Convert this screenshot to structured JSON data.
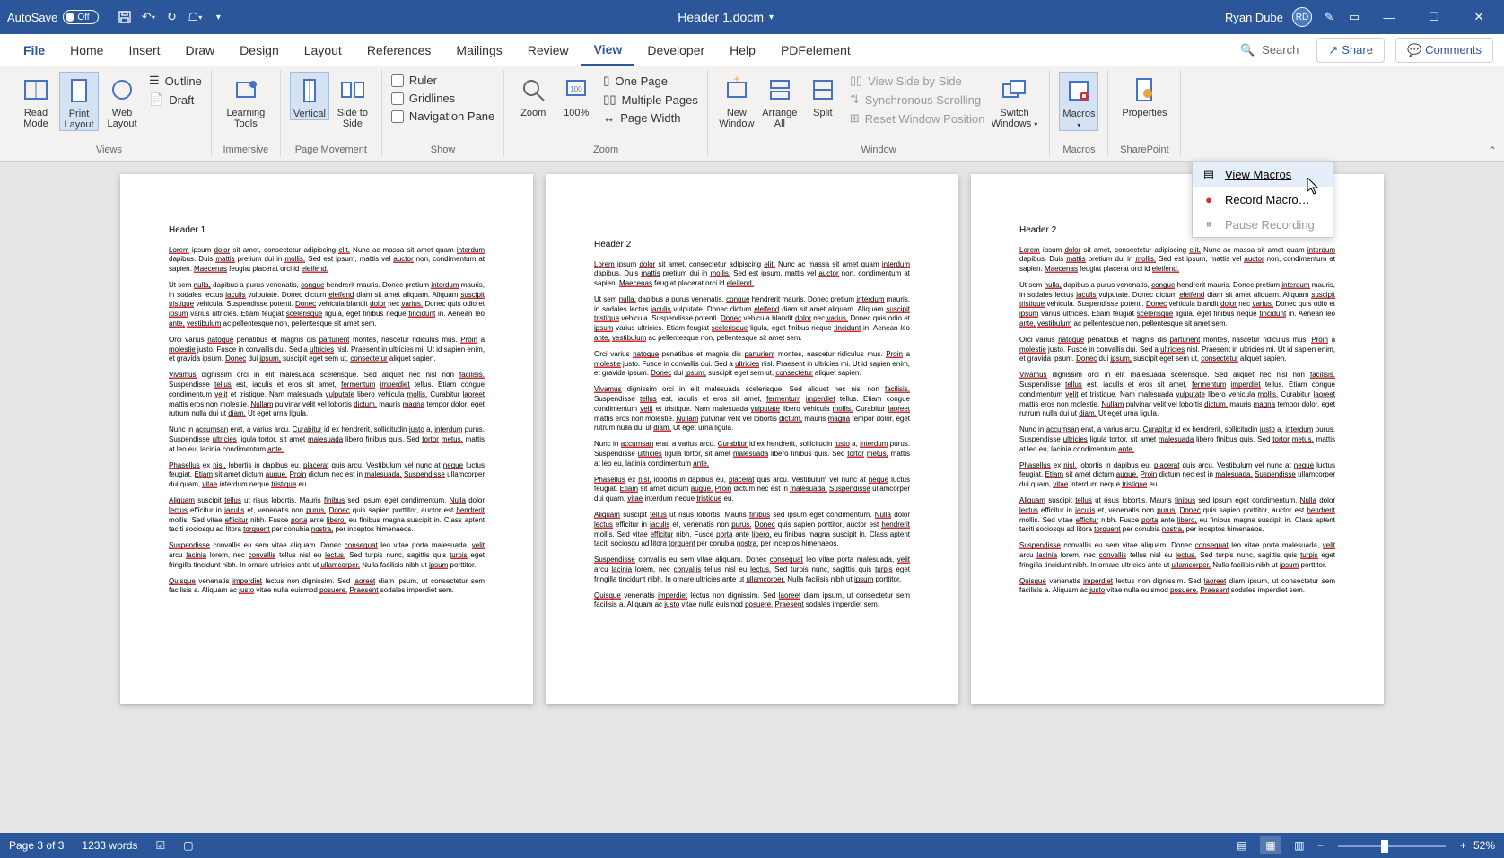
{
  "titlebar": {
    "autosave": "AutoSave",
    "autosave_state": "Off",
    "doc_title": "Header 1.docm",
    "user_name": "Ryan Dube",
    "user_initials": "RD"
  },
  "tabs": {
    "file": "File",
    "items": [
      "Home",
      "Insert",
      "Draw",
      "Design",
      "Layout",
      "References",
      "Mailings",
      "Review",
      "View",
      "Developer",
      "Help",
      "PDFelement"
    ],
    "active_index": 8,
    "search_placeholder": "Search",
    "share": "Share",
    "comments": "Comments"
  },
  "ribbon": {
    "groups": {
      "views": {
        "label": "Views",
        "read_mode": "Read Mode",
        "print_layout": "Print Layout",
        "web_layout": "Web Layout",
        "outline": "Outline",
        "draft": "Draft"
      },
      "immersive": {
        "label": "Immersive",
        "learning_tools": "Learning Tools"
      },
      "page_movement": {
        "label": "Page Movement",
        "vertical": "Vertical",
        "side": "Side to Side"
      },
      "show": {
        "label": "Show",
        "ruler": "Ruler",
        "gridlines": "Gridlines",
        "nav": "Navigation Pane"
      },
      "zoom": {
        "label": "Zoom",
        "zoom": "Zoom",
        "hundred": "100%",
        "one_page": "One Page",
        "multi": "Multiple Pages",
        "page_width": "Page Width"
      },
      "window": {
        "label": "Window",
        "new": "New Window",
        "arrange": "Arrange All",
        "split": "Split",
        "side_by_side": "View Side by Side",
        "sync": "Synchronous Scrolling",
        "reset": "Reset Window Position",
        "switch": "Switch Windows"
      },
      "macros": {
        "label": "Macros",
        "macros": "Macros",
        "view_macros": "View Macros",
        "record": "Record Macro…",
        "pause": "Pause Recording"
      },
      "sharepoint": {
        "label": "SharePoint",
        "properties": "Properties"
      }
    }
  },
  "document": {
    "pages": [
      {
        "header": "Header 1",
        "paragraphs": [
          "Lorem ipsum dolor sit amet, consectetur adipiscing elit. Nunc ac massa sit amet quam interdum dapibus. Duis mattis pretium dui in mollis. Sed est ipsum, mattis vel auctor non, condimentum at sapien. Maecenas feugiat placerat orci id eleifend.",
          "Ut sem nulla, dapibus a purus venenatis, congue hendrerit mauris. Donec pretium interdum mauris, in sodales lectus iaculis vulputate. Donec dictum eleifend diam sit amet aliquam. Aliquam suscipit tristique vehicula. Suspendisse potenti. Donec vehicula blandit dolor nec varius. Donec quis odio et ipsum varius ultricies. Etiam feugiat scelerisque ligula, eget finibus neque tincidunt in. Aenean leo ante, vestibulum ac pellentesque non, pellentesque sit amet sem.",
          "Orci varius natoque penatibus et magnis dis parturient montes, nascetur ridiculus mus. Proin a molestie justo. Fusce in convallis dui. Sed a ultricies nisl. Praesent in ultricies mi. Ut id sapien enim, et gravida ipsum. Donec dui ipsum, suscipit eget sem ut, consectetur aliquet sapien.",
          "Vivamus dignissim orci in elit malesuada scelerisque. Sed aliquet nec nisl non facilisis. Suspendisse tellus est, iaculis et eros sit amet, fermentum imperdiet tellus. Etiam congue condimentum velit et tristique. Nam malesuada vulputate libero vehicula mollis. Curabitur laoreet mattis eros non molestie. Nullam pulvinar velit vel lobortis dictum, mauris magna tempor dolor, eget rutrum nulla dui ut diam. Ut eget urna ligula.",
          "Nunc in accumsan erat, a varius arcu. Curabitur id ex hendrerit, sollicitudin justo a, interdum purus. Suspendisse ultricies ligula tortor, sit amet malesuada libero finibus quis. Sed tortor metus, mattis at leo eu, lacinia condimentum ante.",
          "Phasellus ex nisl, lobortis in dapibus eu, placerat quis arcu. Vestibulum vel nunc at neque luctus feugiat. Etiam sit amet dictum augue. Proin dictum nec est in malesuada. Suspendisse ullamcorper dui quam, vitae interdum neque tristique eu.",
          "Aliquam suscipit tellus ut risus lobortis. Mauris finibus sed ipsum eget condimentum. Nulla dolor lectus efficitur in iaculis et, venenatis non purus. Donec quis sapien porttitor, auctor est hendrerit mollis. Sed vitae efficitur nibh. Fusce porta ante libero, eu finibus magna suscipit in. Class aptent taciti sociosqu ad litora torquent per conubia nostra, per inceptos himenaeos.",
          "Suspendisse convallis eu sem vitae aliquam. Donec consequat leo vitae porta malesuada, velit arcu lacinia lorem, nec convallis tellus nisl eu lectus. Sed turpis nunc, sagittis quis turpis eget fringilla tincidunt nibh. In ornare ultricies ante ut ullamcorper. Nulla facilisis nibh ut ipsum porttitor.",
          "Quisque venenatis imperdiet lectus non dignissim. Sed laoreet diam ipsum, ut consectetur sem facilisis a. Aliquam ac justo vitae nulla euismod posuere. Praesent sodales imperdiet sem."
        ]
      },
      {
        "header": "Header 2",
        "paragraphs": [
          "Lorem ipsum dolor sit amet, consectetur adipiscing elit. Nunc ac massa sit amet quam interdum dapibus. Duis mattis pretium dui in mollis. Sed est ipsum, mattis vel auctor non, condimentum at sapien. Maecenas feugiat placerat orci id eleifend.",
          "Ut sem nulla, dapibus a purus venenatis, congue hendrerit mauris. Donec pretium interdum mauris, in sodales lectus iaculis vulputate. Donec dictum eleifend diam sit amet aliquam. Aliquam suscipit tristique vehicula. Suspendisse potenti. Donec vehicula blandit dolor nec varius. Donec quis odio et ipsum varius ultricies. Etiam feugiat scelerisque ligula, eget finibus neque tincidunt in. Aenean leo ante, vestibulum ac pellentesque non, pellentesque sit amet sem.",
          "Orci varius natoque penatibus et magnis dis parturient montes, nascetur ridiculus mus. Proin a molestie justo. Fusce in convallis dui. Sed a ultricies nisl. Praesent in ultricies mi. Ut id sapien enim, et gravida ipsum. Donec dui ipsum, suscipit eget sem ut, consectetur aliquet sapien.",
          "Vivamus dignissim orci in elit malesuada scelerisque. Sed aliquet nec nisl non facilisis. Suspendisse tellus est, iaculis et eros sit amet, fermentum imperdiet tellus. Etiam congue condimentum velit et tristique. Nam malesuada vulputate libero vehicula mollis. Curabitur laoreet mattis eros non molestie. Nullam pulvinar velit vel lobortis dictum, mauris magna tempor dolor, eget rutrum nulla dui ut diam. Ut eget urna ligula.",
          "Nunc in accumsan erat, a varius arcu. Curabitur id ex hendrerit, sollicitudin justo a, interdum purus. Suspendisse ultricies ligula tortor, sit amet malesuada libero finibus quis. Sed tortor metus, mattis at leo eu, lacinia condimentum ante.",
          "Phasellus ex nisl, lobortis in dapibus eu, placerat quis arcu. Vestibulum vel nunc at neque luctus feugiat. Etiam sit amet dictum augue. Proin dictum nec est in malesuada. Suspendisse ullamcorper dui quam, vitae interdum neque tristique eu.",
          "Aliquam suscipit tellus ut risus lobortis. Mauris finibus sed ipsum eget condimentum. Nulla dolor lectus efficitur in iaculis et, venenatis non purus. Donec quis sapien porttitor, auctor est hendrerit mollis. Sed vitae efficitur nibh. Fusce porta ante libero, eu finibus magna suscipit in. Class aptent taciti sociosqu ad litora torquent per conubia nostra, per inceptos himenaeos.",
          "Suspendisse convallis eu sem vitae aliquam. Donec consequat leo vitae porta malesuada, velit arcu lacinia lorem, nec convallis tellus nisl eu lectus. Sed turpis nunc, sagittis quis turpis eget fringilla tincidunt nibh. In ornare ultricies ante ut ullamcorper. Nulla facilisis nibh ut ipsum porttitor.",
          "Quisque venenatis imperdiet lectus non dignissim. Sed laoreet diam ipsum, ut consectetur sem facilisis a. Aliquam ac justo vitae nulla euismod posuere. Praesent sodales imperdiet sem."
        ]
      },
      {
        "header": "Header 2",
        "paragraphs": [
          "Lorem ipsum dolor sit amet, consectetur adipiscing elit. Nunc ac massa sit amet quam interdum dapibus. Duis mattis pretium dui in mollis. Sed est ipsum, mattis vel auctor non, condimentum at sapien. Maecenas feugiat placerat orci id eleifend.",
          "Ut sem nulla, dapibus a purus venenatis, congue hendrerit mauris. Donec pretium interdum mauris, in sodales lectus iaculis vulputate. Donec dictum eleifend diam sit amet aliquam. Aliquam suscipit tristique vehicula. Suspendisse potenti. Donec vehicula blandit dolor nec varius. Donec quis odio et ipsum varius ultricies. Etiam feugiat scelerisque ligula, eget finibus neque tincidunt in. Aenean leo ante, vestibulum ac pellentesque non, pellentesque sit amet sem.",
          "Orci varius natoque penatibus et magnis dis parturient montes, nascetur ridiculus mus. Proin a molestie justo. Fusce in convallis dui. Sed a ultricies nisl. Praesent in ultricies mi. Ut id sapien enim, et gravida ipsum. Donec dui ipsum, suscipit eget sem ut, consectetur aliquet sapien.",
          "Vivamus dignissim orci in elit malesuada scelerisque. Sed aliquet nec nisl non facilisis. Suspendisse tellus est, iaculis et eros sit amet, fermentum imperdiet tellus. Etiam congue condimentum velit et tristique. Nam malesuada vulputate libero vehicula mollis. Curabitur laoreet mattis eros non molestie. Nullam pulvinar velit vel lobortis dictum, mauris magna tempor dolor, eget rutrum nulla dui ut diam. Ut eget urna ligula.",
          "Nunc in accumsan erat, a varius arcu. Curabitur id ex hendrerit, sollicitudin justo a, interdum purus. Suspendisse ultricies ligula tortor, sit amet malesuada libero finibus quis. Sed tortor metus, mattis at leo eu, lacinia condimentum ante.",
          "Phasellus ex nisl, lobortis in dapibus eu, placerat quis arcu. Vestibulum vel nunc at neque luctus feugiat. Etiam sit amet dictum augue. Proin dictum nec est in malesuada. Suspendisse ullamcorper dui quam, vitae interdum neque tristique eu.",
          "Aliquam suscipit tellus ut risus lobortis. Mauris finibus sed ipsum eget condimentum. Nulla dolor lectus efficitur in iaculis et, venenatis non purus. Donec quis sapien porttitor, auctor est hendrerit mollis. Sed vitae efficitur nibh. Fusce porta ante libero, eu finibus magna suscipit in. Class aptent taciti sociosqu ad litora torquent per conubia nostra, per inceptos himenaeos.",
          "Suspendisse convallis eu sem vitae aliquam. Donec consequat leo vitae porta malesuada, velit arcu lacinia lorem, nec convallis tellus nisl eu lectus. Sed turpis nunc, sagittis quis turpis eget fringilla tincidunt nibh. In ornare ultricies ante ut ullamcorper. Nulla facilisis nibh ut ipsum porttitor.",
          "Quisque venenatis imperdiet lectus non dignissim. Sed laoreet diam ipsum, ut consectetur sem facilisis a. Aliquam ac justo vitae nulla euismod posuere. Praesent sodales imperdiet sem."
        ]
      }
    ]
  },
  "statusbar": {
    "page": "Page 3 of 3",
    "words": "1233 words",
    "zoom": "52%"
  }
}
